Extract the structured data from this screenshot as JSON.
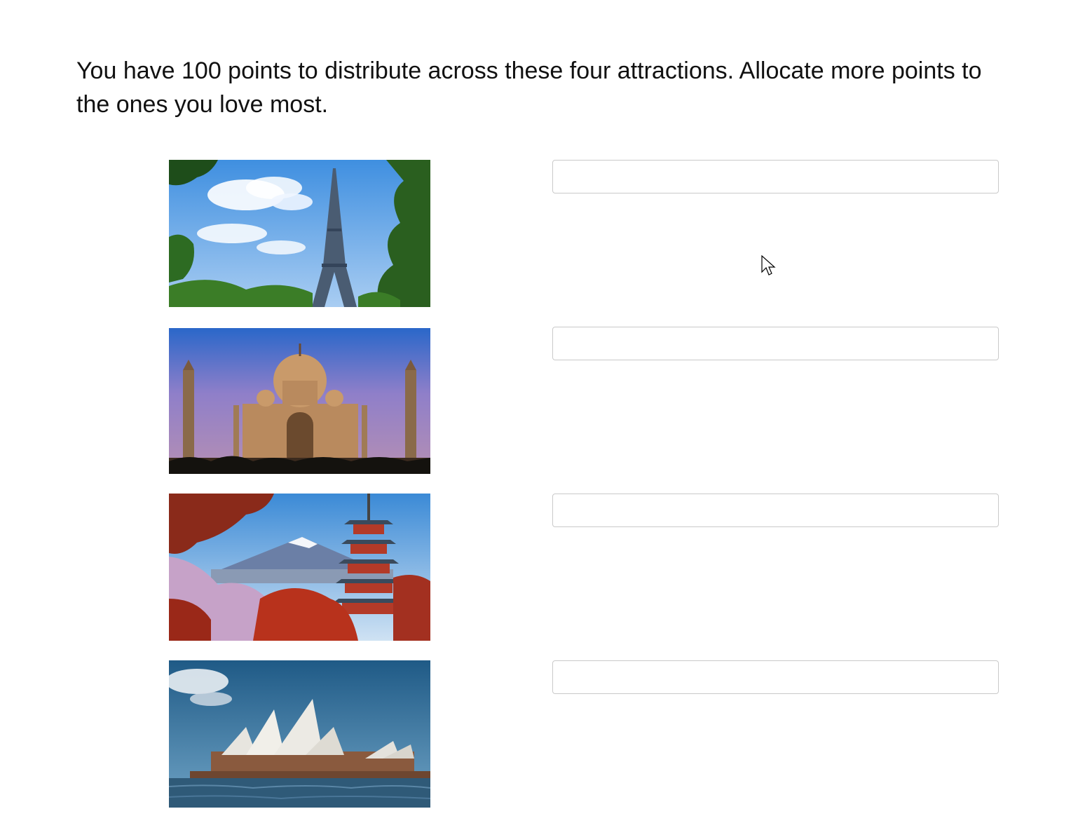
{
  "question": {
    "text": "You have 100 points to distribute across these four attractions. Allocate more points to the ones you love most."
  },
  "attractions": [
    {
      "image_icon": "eiffel-tower-photo",
      "input_value": ""
    },
    {
      "image_icon": "taj-mahal-photo",
      "input_value": ""
    },
    {
      "image_icon": "mount-fuji-pagoda-photo",
      "input_value": ""
    },
    {
      "image_icon": "sydney-opera-house-photo",
      "input_value": ""
    }
  ],
  "colors": {
    "input_border": "#c9c9c9",
    "text": "#111111",
    "background": "#ffffff"
  }
}
